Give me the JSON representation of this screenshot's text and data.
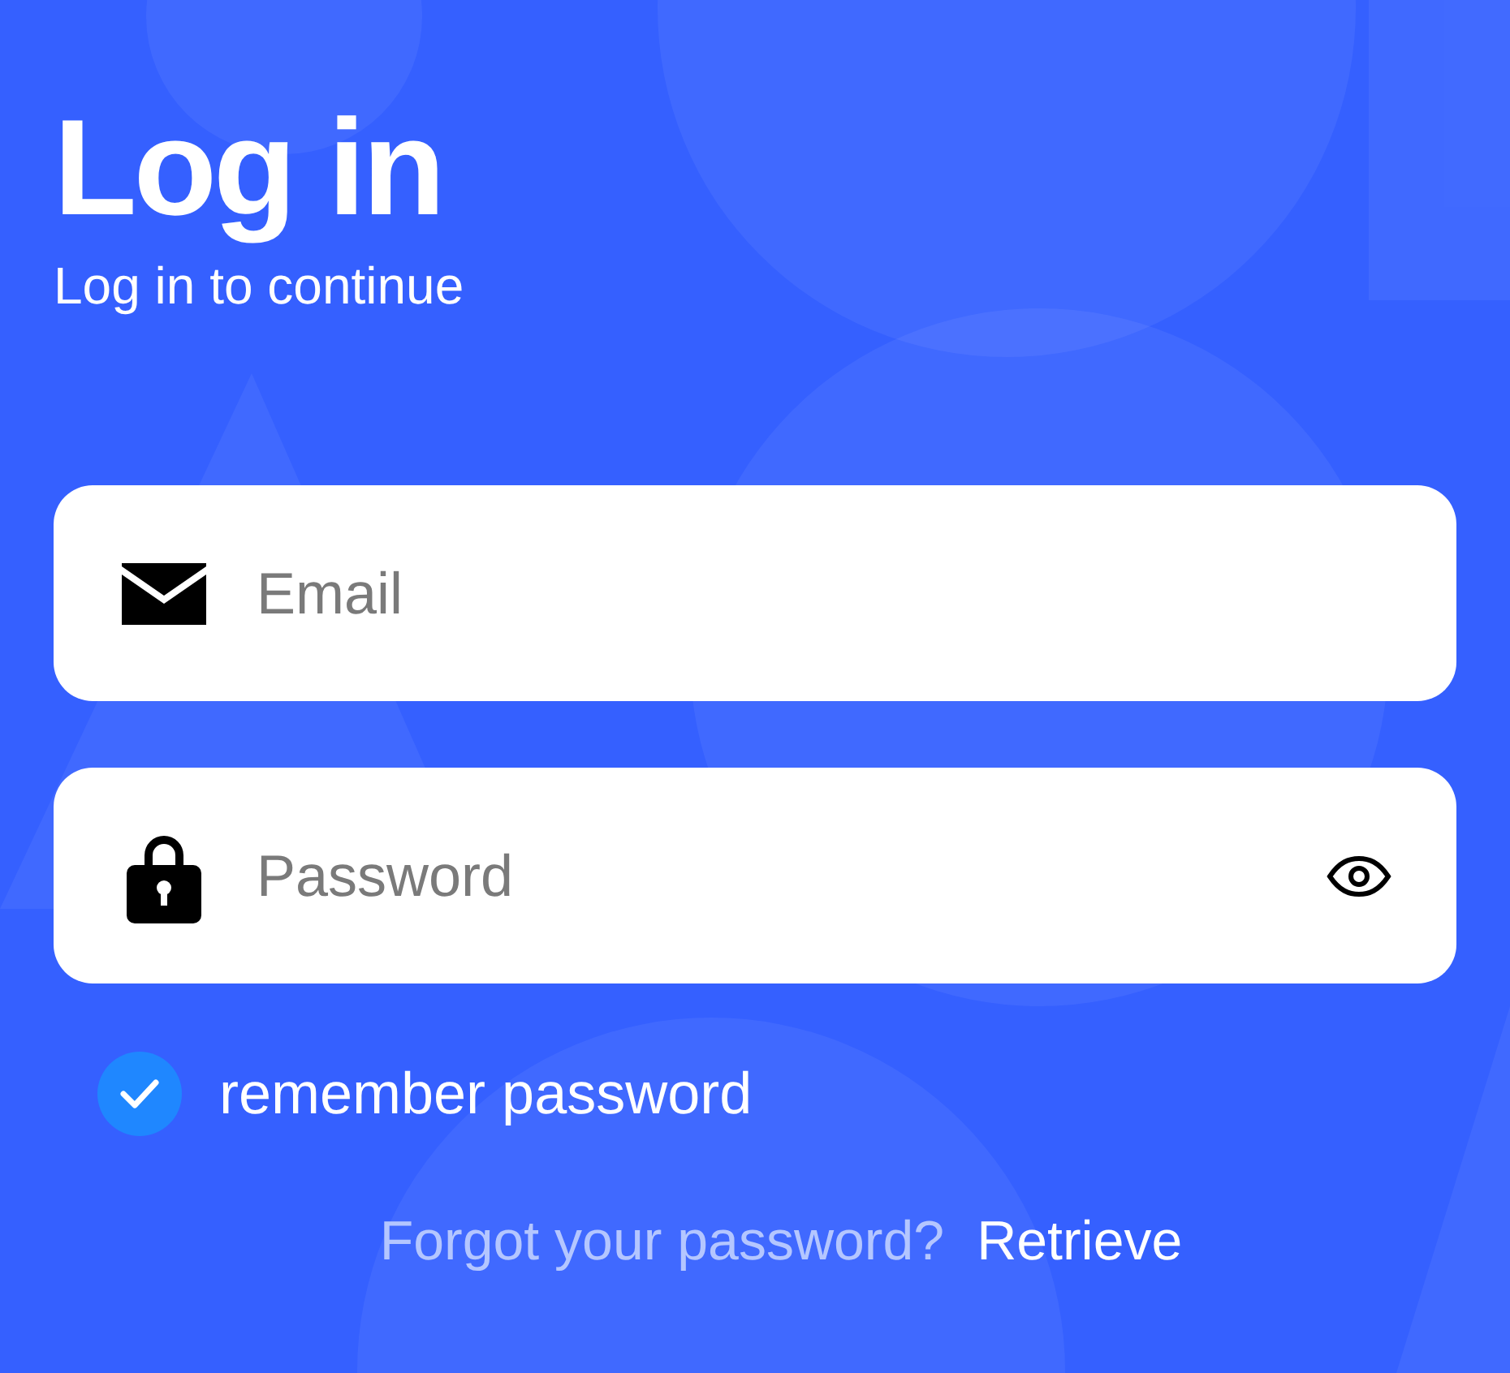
{
  "title": "Log in",
  "subtitle": "Log in to continue",
  "fields": [
    {
      "kind": "email",
      "placeholder": "Email"
    },
    {
      "kind": "password",
      "placeholder": "Password"
    }
  ],
  "remember": {
    "label": "remember password",
    "checked": true
  },
  "forgot": {
    "text": "Forgot your password?",
    "link": "Retrieve"
  }
}
